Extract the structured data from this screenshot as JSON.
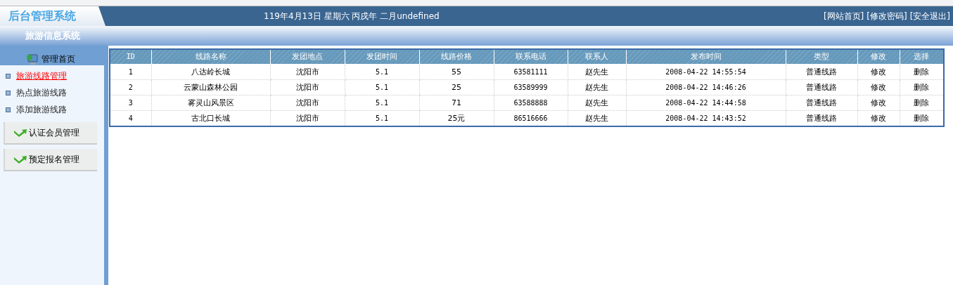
{
  "header": {
    "logo": "后台管理系统",
    "date": "119年4月13日 星期六 丙戌年 二月undefined",
    "links": [
      "[网站首页]",
      "[修改密码]",
      "[安全退出]"
    ]
  },
  "subtitle": "旅游信息系统",
  "sidebar": {
    "home": "管理首页",
    "items": [
      {
        "label": "旅游线路管理",
        "selected": true
      },
      {
        "label": "热点旅游线路",
        "selected": false
      },
      {
        "label": "添加旅游线路",
        "selected": false
      }
    ],
    "sections": [
      "认证会员管理",
      "预定报名管理"
    ]
  },
  "table": {
    "columns": [
      "ID",
      "线路名称",
      "发团地点",
      "发团时间",
      "线路价格",
      "联系电话",
      "联系人",
      "发布时间",
      "类型",
      "修改",
      "选择"
    ],
    "rows": [
      [
        "1",
        "八达岭长城",
        "沈阳市",
        "5.1",
        "55",
        "63581111",
        "赵先生",
        "2008-04-22 14:55:54",
        "普通线路",
        "修改",
        "删除"
      ],
      [
        "2",
        "云蒙山森林公园",
        "沈阳市",
        "5.1",
        "25",
        "63589999",
        "赵先生",
        "2008-04-22 14:46:26",
        "普通线路",
        "修改",
        "删除"
      ],
      [
        "3",
        "雾灵山风景区",
        "沈阳市",
        "5.1",
        "71",
        "63588888",
        "赵先生",
        "2008-04-22 14:44:58",
        "普通线路",
        "修改",
        "删除"
      ],
      [
        "4",
        "古北口长城",
        "沈阳市",
        "5.1",
        "25元",
        "86516666",
        "赵先生",
        "2008-04-22 14:43:52",
        "普通线路",
        "修改",
        "删除"
      ]
    ]
  }
}
